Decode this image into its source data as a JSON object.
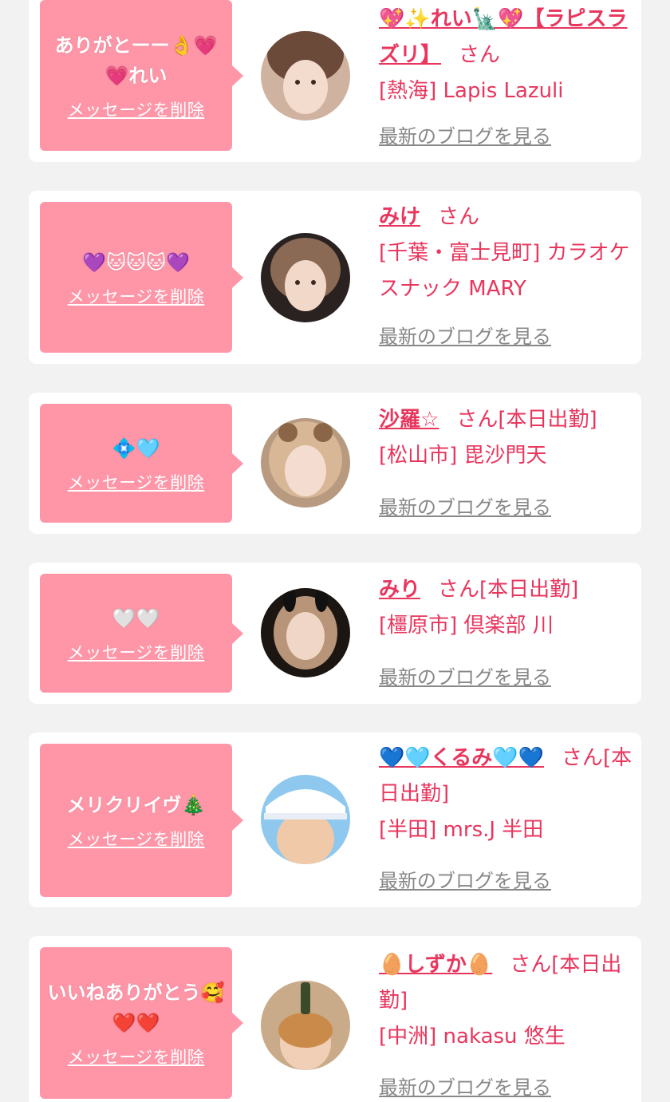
{
  "entries": [
    {
      "message": "ありがとーー👌💗💗れい",
      "delete_label": "メッセージを削除",
      "name": "💖✨れい🗽💖【ラピスラズリ】",
      "san": "さん",
      "status": "",
      "shop": "[熱海] Lapis Lazuli",
      "blog_label": "最新のブログを見る"
    },
    {
      "message": "💜🐱🐱🐱💜",
      "delete_label": "メッセージを削除",
      "name": "みけ",
      "san": "さん",
      "status": "",
      "shop": "[千葉・富士見町] カラオケスナック MARY",
      "blog_label": "最新のブログを見る"
    },
    {
      "message": "💠🩵",
      "delete_label": "メッセージを削除",
      "name": "沙羅☆",
      "san": "さん",
      "status": "[本日出勤]",
      "shop": "[松山市] 毘沙門天",
      "blog_label": "最新のブログを見る"
    },
    {
      "message": "🤍🤍",
      "delete_label": "メッセージを削除",
      "name": "みり",
      "san": "さん",
      "status": "[本日出勤]",
      "shop": "[橿原市] 倶楽部 川",
      "blog_label": "最新のブログを見る"
    },
    {
      "message": "メリクリイヴ🎄",
      "delete_label": "メッセージを削除",
      "name": "💙🩵くるみ🩵💙",
      "san": "さん",
      "status": "[本日出勤]",
      "shop": "[半田] mrs.J 半田",
      "blog_label": "最新のブログを見る"
    },
    {
      "message": "いいねありがとう🥰❤️❤️",
      "delete_label": "メッセージを削除",
      "name": "🥚しずか🥚",
      "san": "さん",
      "status": "[本日出勤]",
      "shop": "[中洲] nakasu 悠生",
      "blog_label": "最新のブログを見る"
    }
  ],
  "colors": {
    "page_background": "#f2f2f2",
    "card_background": "#ffffff",
    "bubble_pink": "#fe96a8",
    "accent_red": "#e8365d",
    "blog_link_gray": "#888888"
  }
}
